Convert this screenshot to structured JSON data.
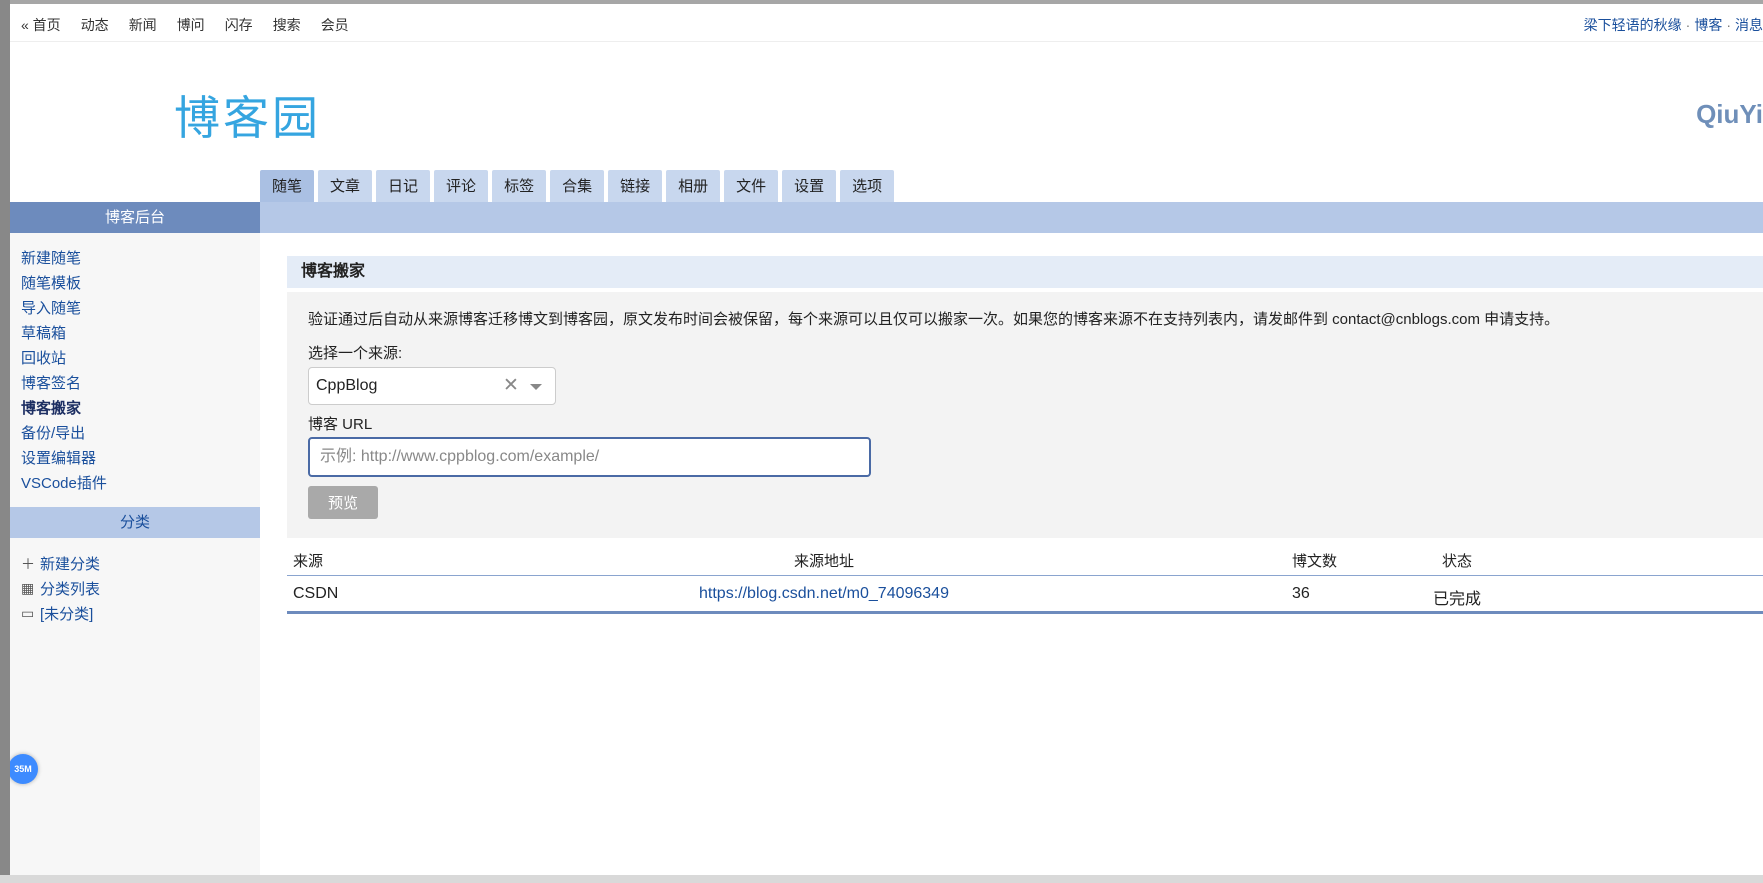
{
  "topnav": {
    "links": [
      "« 首页",
      "动态",
      "新闻",
      "博问",
      "闪存",
      "搜索",
      "会员"
    ],
    "right_user": "梁下轻语的秋缘",
    "right_blog": "博客",
    "right_msg": "消息"
  },
  "header": {
    "logo_text": "博客园",
    "user_name": "QiuYi"
  },
  "tabs": [
    "随笔",
    "文章",
    "日记",
    "评论",
    "标签",
    "合集",
    "链接",
    "相册",
    "文件",
    "设置",
    "选项"
  ],
  "active_tab": "随笔",
  "sidebar": {
    "title": "博客后台",
    "items": [
      "新建随笔",
      "随笔模板",
      "导入随笔",
      "草稿箱",
      "回收站",
      "博客签名",
      "博客搬家",
      "备份/导出",
      "设置编辑器",
      "VSCode插件"
    ],
    "current": "博客搬家",
    "category_title": "分类",
    "categories": [
      {
        "icon": "plus-icon",
        "label": "新建分类"
      },
      {
        "icon": "list-icon",
        "label": "分类列表"
      },
      {
        "icon": "folder-icon",
        "label": "[未分类]"
      }
    ],
    "memory_badge": "35M"
  },
  "main": {
    "panel_title": "博客搬家",
    "description": "验证通过后自动从来源博客迁移博文到博客园，原文发布时间会被保留，每个来源可以且仅可以搬家一次。如果您的博客来源不在支持列表内，请发邮件到 contact@cnblogs.com 申请支持。",
    "source_label": "选择一个来源:",
    "source_value": "CppBlog",
    "url_label": "博客 URL",
    "url_placeholder": "示例: http://www.cppblog.com/example/",
    "preview_button": "预览"
  },
  "table": {
    "headers": [
      "来源",
      "来源地址",
      "博文数",
      "状态"
    ],
    "rows": [
      {
        "source": "CSDN",
        "url": "https://blog.csdn.net/m0_74096349",
        "count": "36",
        "status": "已完成"
      }
    ]
  },
  "colors": {
    "accent": "#6d8bbd",
    "tab": "#c8d7ee",
    "link": "#1a4f9c",
    "logo": "#35a5e0"
  }
}
